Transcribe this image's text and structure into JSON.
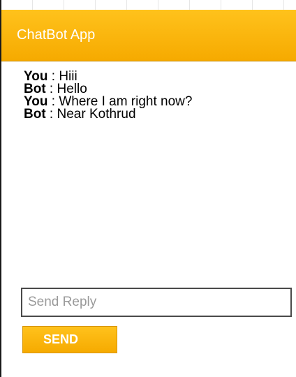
{
  "header": {
    "title": "ChatBot App"
  },
  "chat": {
    "messages": [
      {
        "sender": "You",
        "separator": " : ",
        "text": "Hiii"
      },
      {
        "sender": "Bot",
        "separator": " : ",
        "text": "Hello"
      },
      {
        "sender": "You",
        "separator": " : ",
        "text": "Where I am right now?"
      },
      {
        "sender": "Bot",
        "separator": " : ",
        "text": "Near Kothrud"
      }
    ]
  },
  "composer": {
    "placeholder": "Send Reply",
    "value": "",
    "send_label": "SEND"
  },
  "colors": {
    "accent": "#f6aa00",
    "accent_light": "#ffc21c",
    "header_text": "#ffffff"
  }
}
